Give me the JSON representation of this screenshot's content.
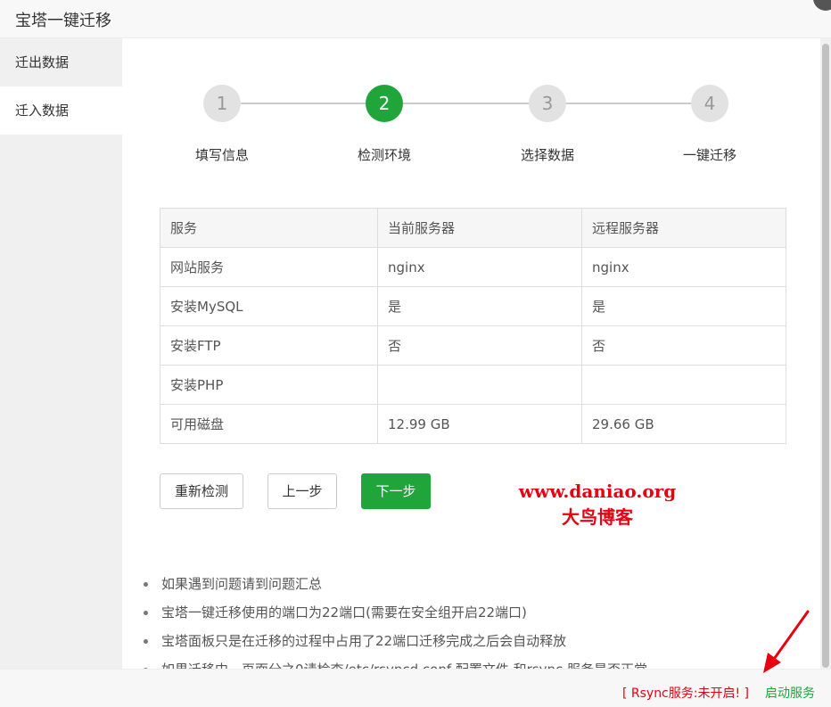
{
  "window": {
    "title": "宝塔一键迁移"
  },
  "sidebar": {
    "items": [
      {
        "label": "迁出数据"
      },
      {
        "label": "迁入数据"
      }
    ]
  },
  "steps": [
    {
      "number": "1",
      "label": "填写信息"
    },
    {
      "number": "2",
      "label": "检测环境"
    },
    {
      "number": "3",
      "label": "选择数据"
    },
    {
      "number": "4",
      "label": "一键迁移"
    }
  ],
  "current_step": 2,
  "table": {
    "headers": [
      "服务",
      "当前服务器",
      "远程服务器"
    ],
    "rows": [
      [
        "网站服务",
        "nginx",
        "nginx"
      ],
      [
        "安装MySQL",
        "是",
        "是"
      ],
      [
        "安装FTP",
        "否",
        "否"
      ],
      [
        "安装PHP",
        "",
        ""
      ],
      [
        "可用磁盘",
        "12.99 GB",
        "29.66 GB"
      ]
    ]
  },
  "buttons": {
    "recheck": "重新检测",
    "prev": "上一步",
    "next": "下一步"
  },
  "watermark": {
    "url": "www.daniao.org",
    "name": "大鸟博客"
  },
  "notes": [
    "如果遇到问题请到问题汇总",
    "宝塔一键迁移使用的端口为22端口(需要在安全组开启22端口)",
    "宝塔面板只是在迁移的过程中占用了22端口迁移完成之后会自动释放",
    "如果迁移中，页面分之0请检查/etc/rsyncd.conf 配置文件 和rsync 服务是否正常"
  ],
  "footer": {
    "status": "[ Rsync服务:未开启! ]",
    "start_label": "启动服务"
  },
  "colors": {
    "accent": "#20a53a",
    "warning": "#e60012",
    "arrow": "#e60012"
  }
}
